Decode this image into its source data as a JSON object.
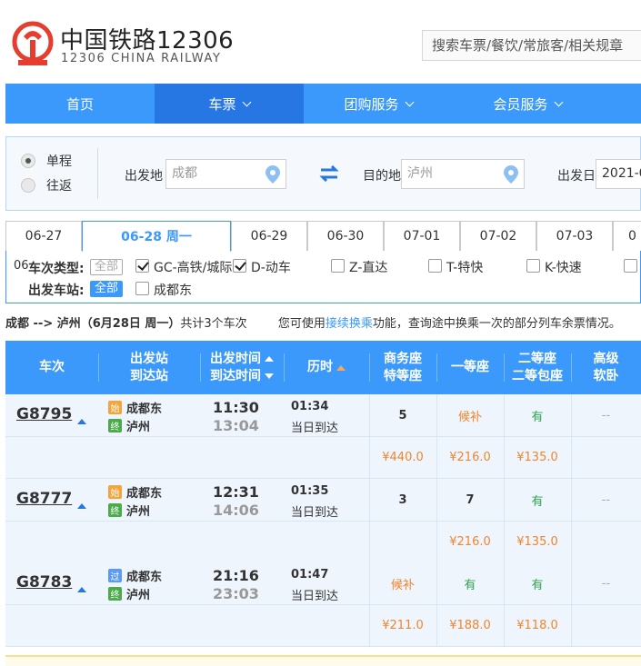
{
  "header": {
    "brand_cn": "中国铁路12306",
    "brand_en": "12306 CHINA RAILWAY",
    "search_placeholder": "搜索车票/餐饮/常旅客/相关规章"
  },
  "nav": {
    "items": [
      {
        "label": "首页",
        "has_dropdown": false,
        "active": false
      },
      {
        "label": "车票",
        "has_dropdown": true,
        "active": true
      },
      {
        "label": "团购服务",
        "has_dropdown": true,
        "active": false
      },
      {
        "label": "会员服务",
        "has_dropdown": true,
        "active": false
      }
    ]
  },
  "query": {
    "trip_one_way": "单程",
    "trip_round": "往返",
    "from_label": "出发地",
    "from_value": "成都",
    "to_label": "目的地",
    "to_value": "泸州",
    "date_label": "出发日",
    "date_value": "2021-0"
  },
  "dates": {
    "tabs": [
      "06-27",
      "06-28 周一",
      "06-29",
      "06-30",
      "07-01",
      "07-02",
      "07-03",
      "0"
    ]
  },
  "filters": {
    "type_label": "车次类型:",
    "type_label_overlap": "06",
    "all": "全部",
    "types": [
      {
        "label": "GC-高铁/城际",
        "checked": true
      },
      {
        "label": "D-动车",
        "checked": true
      },
      {
        "label": "Z-直达",
        "checked": false
      },
      {
        "label": "T-特快",
        "checked": false
      },
      {
        "label": "K-快速",
        "checked": false
      }
    ],
    "station_label": "出发车站:",
    "station_all": "全部",
    "stations": [
      {
        "label": "成都东",
        "checked": false
      }
    ]
  },
  "summary": {
    "route": "成都 --> 泸州（6月28日  周一）",
    "count_text": "共计3个车次",
    "hint_pre": "您可使用",
    "hint_link": "接续换乘",
    "hint_post": "功能，查询途中换乘一次的部分列车余票情况。"
  },
  "table": {
    "headers": {
      "train": "车次",
      "station_1": "出发站",
      "station_2": "到达站",
      "time_1": "出发时间",
      "time_2": "到达时间",
      "duration": "历时",
      "business_1": "商务座",
      "business_2": "特等座",
      "first": "一等座",
      "second_1": "二等座",
      "second_2": "二等包座",
      "soft_1": "高级",
      "soft_2": "软卧"
    },
    "rows": [
      {
        "train_no": "G8795",
        "from_badge": "始",
        "from": "成都东",
        "to_badge": "终",
        "to": "泸州",
        "depart": "11:30",
        "arrive": "13:04",
        "duration": "01:34",
        "arrive_day": "当日到达",
        "business": "5",
        "first": "候补",
        "second": "有",
        "soft": "--",
        "price_business": "¥440.0",
        "price_first": "¥216.0",
        "price_second": "¥135.0"
      },
      {
        "train_no": "G8777",
        "from_badge": "始",
        "from": "成都东",
        "to_badge": "终",
        "to": "泸州",
        "depart": "12:31",
        "arrive": "14:06",
        "duration": "01:35",
        "arrive_day": "当日到达",
        "business": "3",
        "first": "7",
        "second": "有",
        "soft": "--",
        "price_business": "",
        "price_first": "¥216.0",
        "price_second": "¥135.0"
      },
      {
        "train_no": "G8783",
        "from_badge": "过",
        "from": "成都东",
        "to_badge": "终",
        "to": "泸州",
        "depart": "21:16",
        "arrive": "23:03",
        "duration": "01:47",
        "arrive_day": "当日到达",
        "business": "候补",
        "first": "有",
        "second": "有",
        "soft": "--",
        "price_business": "¥211.0",
        "price_first": "¥188.0",
        "price_second": "¥118.0"
      }
    ]
  },
  "colors": {
    "primary": "#3b99fc",
    "primary_dark": "#2676e3",
    "brand_red": "#e53d2f",
    "orange": "#f0852d",
    "green": "#2ea44f"
  }
}
